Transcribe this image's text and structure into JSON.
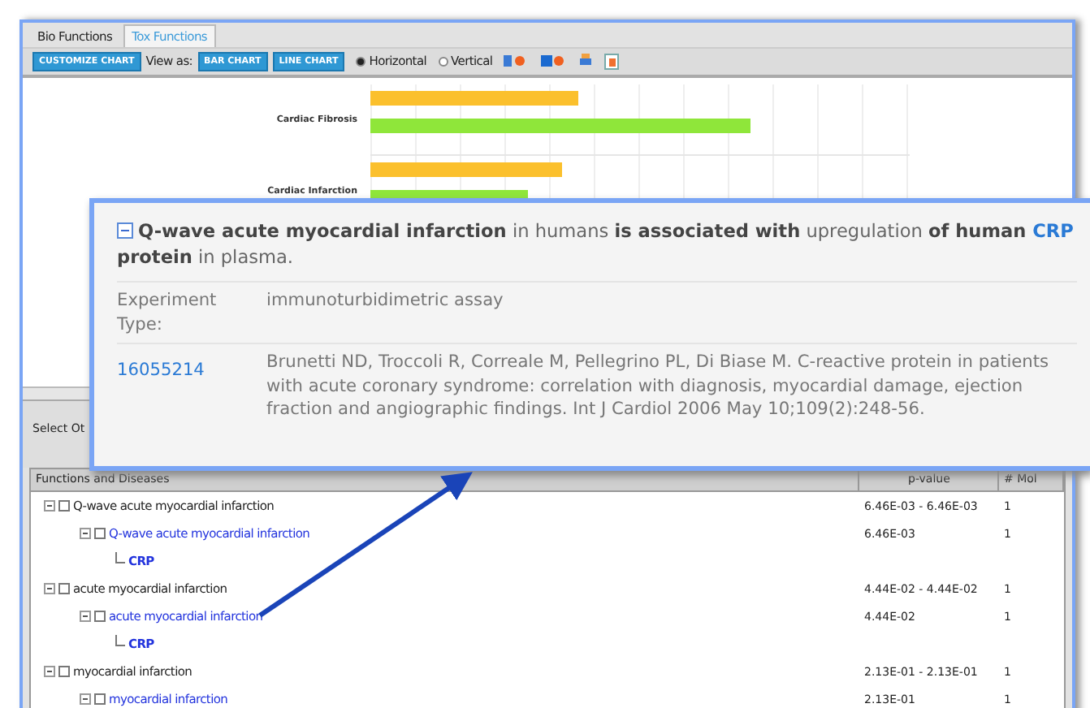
{
  "tabs": [
    {
      "label": "Bio Functions",
      "selected": false
    },
    {
      "label": "Tox Functions",
      "selected": true
    }
  ],
  "toolbar": {
    "customize_button": "CUSTOMIZE CHART",
    "view_label": "View as:",
    "view_buttons": [
      "BAR CHART",
      "LINE CHART"
    ],
    "orientation": [
      {
        "label": "Horizontal",
        "selected": true
      },
      {
        "label": "Vertical",
        "selected": false
      }
    ]
  },
  "chart_rows": [
    {
      "label": "Cardiac Fibrosis"
    },
    {
      "label": "Cardiac Infarction"
    }
  ],
  "lower_panel": {
    "select_label": "Select Ot"
  },
  "table": {
    "columns": [
      "Functions and Diseases",
      "p-value",
      "# Mol"
    ],
    "rows": [
      {
        "label": "Q-wave acute myocardial infarction",
        "checked": false,
        "p_value": "6.46E-03 - 6.46E-03",
        "count": "1",
        "children": [
          {
            "label": "Q-wave acute myocardial infarction",
            "checked": false,
            "p_value": "6.46E-03",
            "count": "1",
            "children": [
              {
                "label": "CRP"
              }
            ]
          }
        ]
      },
      {
        "label": "acute myocardial infarction",
        "checked": false,
        "p_value": "4.44E-02 - 4.44E-02",
        "count": "1",
        "children": [
          {
            "label": "acute myocardial infarction",
            "checked": false,
            "p_value": "4.44E-02",
            "count": "1",
            "children": [
              {
                "label": "CRP"
              }
            ]
          }
        ]
      },
      {
        "label": "myocardial infarction",
        "checked": false,
        "p_value": "2.13E-01 - 2.13E-01",
        "count": "1",
        "children": [
          {
            "label": "myocardial infarction",
            "checked": false,
            "p_value": "2.13E-01",
            "count": "1"
          }
        ]
      }
    ]
  },
  "popup": {
    "expanded": true,
    "title": [
      {
        "text": "Q-wave acute myocardial infarction",
        "kind": "bold"
      },
      {
        "text": " in humans ",
        "kind": "plain"
      },
      {
        "text": "is associated with",
        "kind": "bold"
      },
      {
        "text": " upregulation ",
        "kind": "plain"
      },
      {
        "text": "of human ",
        "kind": "bold"
      },
      {
        "text": "CRP",
        "kind": "link"
      },
      {
        "text": " protein",
        "kind": "bold"
      },
      {
        "text": " in plasma.",
        "kind": "plain"
      }
    ],
    "experiment_type_label": "Experiment Type:",
    "experiment_type": "immunoturbidimetric assay",
    "pubmed_id": "16055214",
    "citation": "Brunetti ND, Troccoli R, Correale M, Pellegrino PL, Di Biase M. C-reactive protein in patients with acute coronary syndrome: correlation with diagnosis, myocardial damage, ejection fraction and angiographic findings. Int J Cardiol 2006 May 10;109(2):248-56."
  }
}
